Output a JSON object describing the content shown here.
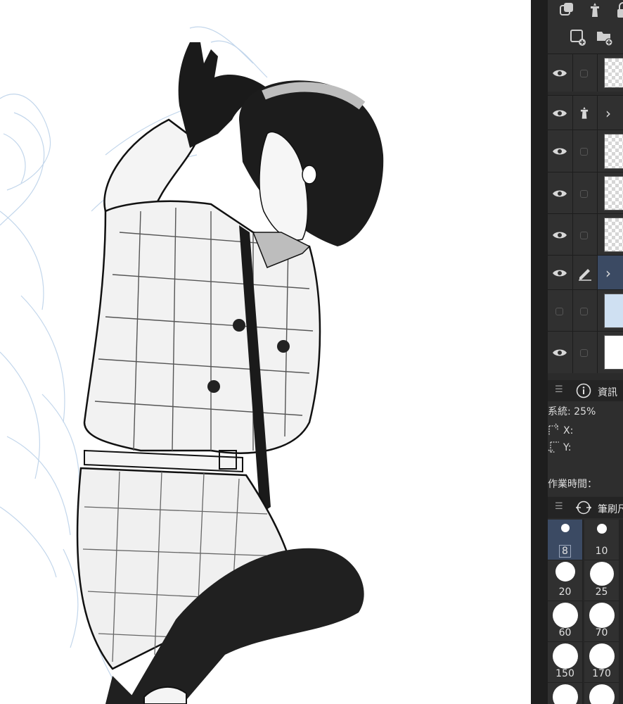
{
  "canvas": {
    "artwork_name": "illustration-canvas"
  },
  "layers_panel": {
    "toolbar_icons": [
      "copy-layer-icon",
      "reference-layer-icon",
      "lock-icon",
      "new-raster-layer-icon",
      "new-folder-icon"
    ],
    "layers": [
      {
        "visible": true,
        "second": "checkbox",
        "thumb": "transparent",
        "expand": false,
        "selected": false
      },
      {
        "visible": true,
        "second": "reference-icon",
        "thumb": "folder",
        "expand": true,
        "selected": false
      },
      {
        "visible": true,
        "second": "checkbox",
        "thumb": "transparent",
        "expand": false,
        "selected": false
      },
      {
        "visible": true,
        "second": "checkbox",
        "thumb": "transparent",
        "expand": false,
        "selected": false
      },
      {
        "visible": true,
        "second": "checkbox",
        "thumb": "transparent",
        "expand": false,
        "selected": false
      },
      {
        "visible": true,
        "second": "pen-icon",
        "thumb": "folder",
        "expand": true,
        "selected": true
      },
      {
        "visible": false,
        "second": "checkbox",
        "thumb": "sketch",
        "expand": false,
        "selected": false
      },
      {
        "visible": true,
        "second": "checkbox",
        "thumb": "white",
        "expand": false,
        "selected": false
      }
    ]
  },
  "info_panel": {
    "title": "資訊",
    "system": "系統: 25%",
    "x_label": "X:",
    "y_label": "Y:",
    "work_time": "作業時間："
  },
  "brush_panel": {
    "title": "筆刷尺",
    "sizes": [
      "8",
      "10",
      "20",
      "25",
      "60",
      "70",
      "150",
      "170",
      "",
      ""
    ],
    "selected_index": 0
  },
  "colors": {
    "panel_bg": "#2b2b2b",
    "selected": "#3b4a63",
    "text": "#e6e6e6"
  }
}
